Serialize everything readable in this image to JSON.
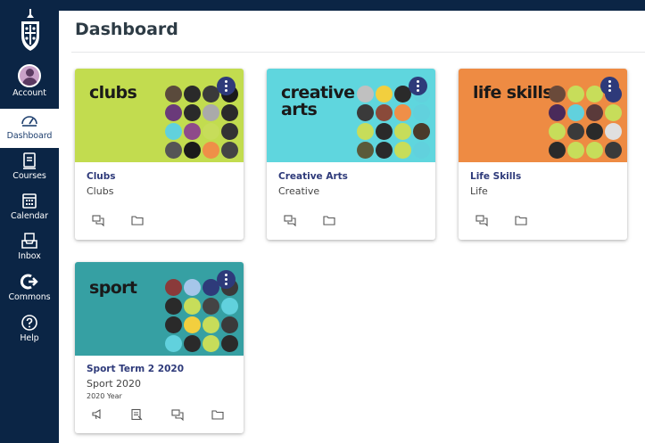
{
  "nav": {
    "items": [
      {
        "label": "Account",
        "icon": "avatar"
      },
      {
        "label": "Dashboard",
        "icon": "dashboard-icon",
        "active": true
      },
      {
        "label": "Courses",
        "icon": "courses-icon"
      },
      {
        "label": "Calendar",
        "icon": "calendar-icon"
      },
      {
        "label": "Inbox",
        "icon": "inbox-icon"
      },
      {
        "label": "Commons",
        "icon": "commons-icon"
      },
      {
        "label": "Help",
        "icon": "help-icon"
      }
    ]
  },
  "header": {
    "title": "Dashboard"
  },
  "accent": "#2e3a7a",
  "cards": [
    {
      "hero_text": "clubs",
      "hero_color": "#c2dc4f",
      "link": "Clubs",
      "subtitle": "Clubs",
      "term": "",
      "icons": [
        "discussions-icon",
        "files-icon"
      ],
      "circle_colors": [
        "#5a4a3c",
        "#2a2a2a",
        "#3a3a3a",
        "#1a1a1a",
        "#6a3a7a",
        "#2a2a2a",
        "#aaaaaa",
        "#2a2a2a",
        "#61d1dd",
        "#8e4a8a",
        "#c7dd5a",
        "#333333",
        "#555555",
        "#1a1a1a",
        "#ef8f48",
        "#444444"
      ]
    },
    {
      "hero_text": "creative\narts",
      "hero_color": "#5fd6de",
      "link": "Creative Arts",
      "subtitle": "Creative",
      "term": "",
      "icons": [
        "discussions-icon",
        "files-icon"
      ],
      "circle_colors": [
        "#c0c0c0",
        "#f2cf3e",
        "#2a2a2a",
        "#61d1dd",
        "#3a3a3a",
        "#8a4a3a",
        "#ef8f48",
        "#61d1dd",
        "#c7dd5a",
        "#2a2a2a",
        "#c7dd5a",
        "#4a3a2a",
        "#5a5a3a",
        "#2a2a2a",
        "#c7dd5a",
        "#61d1dd"
      ]
    },
    {
      "hero_text": "life skills",
      "hero_color": "#ee8b43",
      "link": "Life Skills",
      "subtitle": "Life",
      "term": "",
      "icons": [
        "discussions-icon",
        "files-icon"
      ],
      "circle_colors": [
        "#6a4a3a",
        "#c7dd5a",
        "#c7dd5a",
        "#2e3a7a",
        "#4a2a5a",
        "#61d1dd",
        "#5a3a3a",
        "#c7dd5a",
        "#c7dd5a",
        "#3a3a3a",
        "#2a2a2a",
        "#e0e0e0",
        "#2a2a2a",
        "#c7dd5a",
        "#c7dd5a",
        "#3a3a3a"
      ]
    },
    {
      "hero_text": "sport",
      "hero_color": "#36a0a3",
      "link": "Sport Term 2 2020",
      "subtitle": "Sport 2020",
      "term": "2020 Year",
      "icons": [
        "announcements-icon",
        "assignments-icon",
        "discussions-icon",
        "files-icon"
      ],
      "circle_colors": [
        "#8a3a3a",
        "#a6c6ea",
        "#2e3a7a",
        "#3a3a3a",
        "#2a2a2a",
        "#c7dd5a",
        "#444444",
        "#61d1dd",
        "#2a2a2a",
        "#f2cf3e",
        "#c7dd5a",
        "#3a3a3a",
        "#61d1dd",
        "#2a2a2a",
        "#c7dd5a",
        "#2a2a2a"
      ]
    }
  ]
}
